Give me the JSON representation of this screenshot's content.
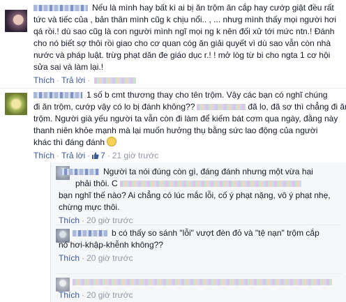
{
  "actions": {
    "like": "Thích",
    "reply": "Trả lời",
    "dot": "·"
  },
  "comments": [
    {
      "lines": [
        "Nếu là mình hay bất kì ai bị ăn trộm ăn cắp hay cướp giật đều rất",
        "tức và tiếc của , bản thân mình cũg k chịu nổi.. , ... nhưg mình thấy mọi người hơi",
        "qá rồi.! dù sao cũg là con người mình ngĩ mọi ng k nên đối xử tới mức ntn.! Đánh",
        "cho nó biết sợ thôi rồi giao cho cơ quan cóg ăn giải quyết vì dù sao vẫn còn nhà",
        "nước và pháp luật. trừg phạt dăn đe giáo dục r.! ! mở lòg từ bi cho ngta 1 cơ hội",
        "sửa sai và làm lại.!"
      ],
      "time": "",
      "likes": ""
    },
    {
      "lines": [
        "1 số b cmt thương thay cho tên trộm. Vậy các bạn có nghĩ chúng",
        "đi ăn trộm, cướp vậy có lo bị đánh không??",
        "đã lo, đã sợ thì chẳng đi ăn",
        "trộm. Người già yếu người ta vẫn còn đi làm để kiếm bát cơm qua ngày, đằng này",
        "thanh niên khỏe mạnh mà lại muốn hưởng thụ bằng sức lao động của người",
        "khác thì đáng đánh"
      ],
      "time": "21 giờ trước",
      "likes": "7"
    },
    {
      "lines": [
        "Người ta nói đúng còn gì, đáng đánh nhưng một vừa hai",
        "phải thôi. C",
        "bạn nghĩ thế nào? Ai chẳng có lúc mắc lỗi, cố ý phạt nặng, vô ý phạt nhẹ,",
        "chừng mực thôi."
      ],
      "time": "20 giờ trước",
      "likes": ""
    },
    {
      "lines": [
        "b có thấy so sánh \"lỗi\" vượt đèn đỏ và \"tệ nạn\" trộm cắp",
        "nó hơi-khập-khễnh không??"
      ],
      "time": "20 giờ trước",
      "likes": ""
    }
  ],
  "colors": {
    "link": "#3b5998",
    "meta": "#9197a3",
    "text": "#141823"
  },
  "icons": [
    "thumbs-up-icon",
    "smile-sticker-icon"
  ]
}
